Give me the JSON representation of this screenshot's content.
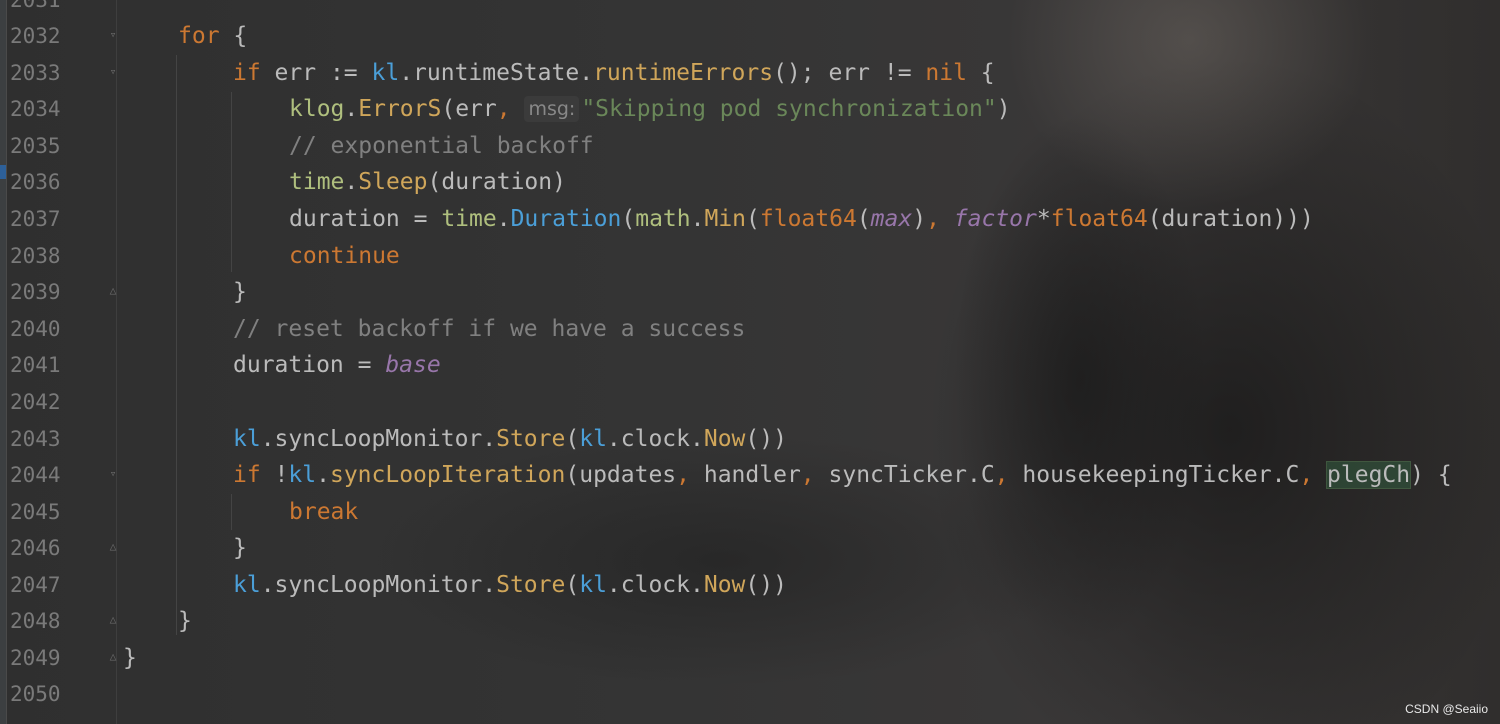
{
  "watermark": "CSDN @Seaiio",
  "lines": {
    "l2032": {
      "num": "2032",
      "kw_for": "for",
      "brace": " {"
    },
    "l2033": {
      "num": "2033",
      "kw_if": "if",
      "t1": " err := ",
      "recv": "kl",
      "t2": ".runtimeState.",
      "m1": "runtimeErrors",
      "t3": "(); err != ",
      "kw_nil": "nil",
      "t4": " {"
    },
    "l2034": {
      "num": "2034",
      "pkg": "klog",
      "t1": ".",
      "fn": "ErrorS",
      "t2": "(err",
      "comma": ",",
      "hint": "msg:",
      "str": "\"Skipping pod synchronization\"",
      "t3": ")"
    },
    "l2035": {
      "num": "2035",
      "cmt": "// exponential backoff"
    },
    "l2036": {
      "num": "2036",
      "pkg": "time",
      "t1": ".",
      "fn": "Sleep",
      "t2": "(duration)"
    },
    "l2037": {
      "num": "2037",
      "t1": "duration = ",
      "pkg1": "time",
      "t2": ".",
      "fn1": "Duration",
      "t3": "(",
      "pkg2": "math",
      "t4": ".",
      "fn2": "Min",
      "t5": "(",
      "typ1": "float64",
      "t6": "(",
      "max": "max",
      "t7": ")",
      "comma": ",",
      "t8": " ",
      "factor": "factor",
      "t9": "*",
      "typ2": "float64",
      "t10": "(duration)))"
    },
    "l2038": {
      "num": "2038",
      "kw": "continue"
    },
    "l2039": {
      "num": "2039",
      "t": "}"
    },
    "l2040": {
      "num": "2040",
      "cmt": "// reset backoff if we have a success"
    },
    "l2041": {
      "num": "2041",
      "t1": "duration = ",
      "base": "base"
    },
    "l2042": {
      "num": "2042"
    },
    "l2043": {
      "num": "2043",
      "recv1": "kl",
      "t1": ".syncLoopMonitor.",
      "m1": "Store",
      "t2": "(",
      "recv2": "kl",
      "t3": ".clock.",
      "m2": "Now",
      "t4": "())"
    },
    "l2044": {
      "num": "2044",
      "kw_if": "if",
      "t1": " !",
      "recv": "kl",
      "t2": ".",
      "m1": "syncLoopIteration",
      "t3": "(updates",
      "c1": ",",
      "t4": " handler",
      "c2": ",",
      "t5": " syncTicker.C",
      "c3": ",",
      "t6": " housekeepingTicker.C",
      "c4": ",",
      "t7": " ",
      "hl": "plegCh",
      "t8": ") {"
    },
    "l2045": {
      "num": "2045",
      "kw": "break"
    },
    "l2046": {
      "num": "2046",
      "t": "}"
    },
    "l2047": {
      "num": "2047",
      "recv1": "kl",
      "t1": ".syncLoopMonitor.",
      "m1": "Store",
      "t2": "(",
      "recv2": "kl",
      "t3": ".clock.",
      "m2": "Now",
      "t4": "())"
    },
    "l2048": {
      "num": "2048",
      "t": "}"
    },
    "l2049": {
      "num": "2049",
      "t": "}"
    },
    "l2050": {
      "num": "2050"
    }
  }
}
